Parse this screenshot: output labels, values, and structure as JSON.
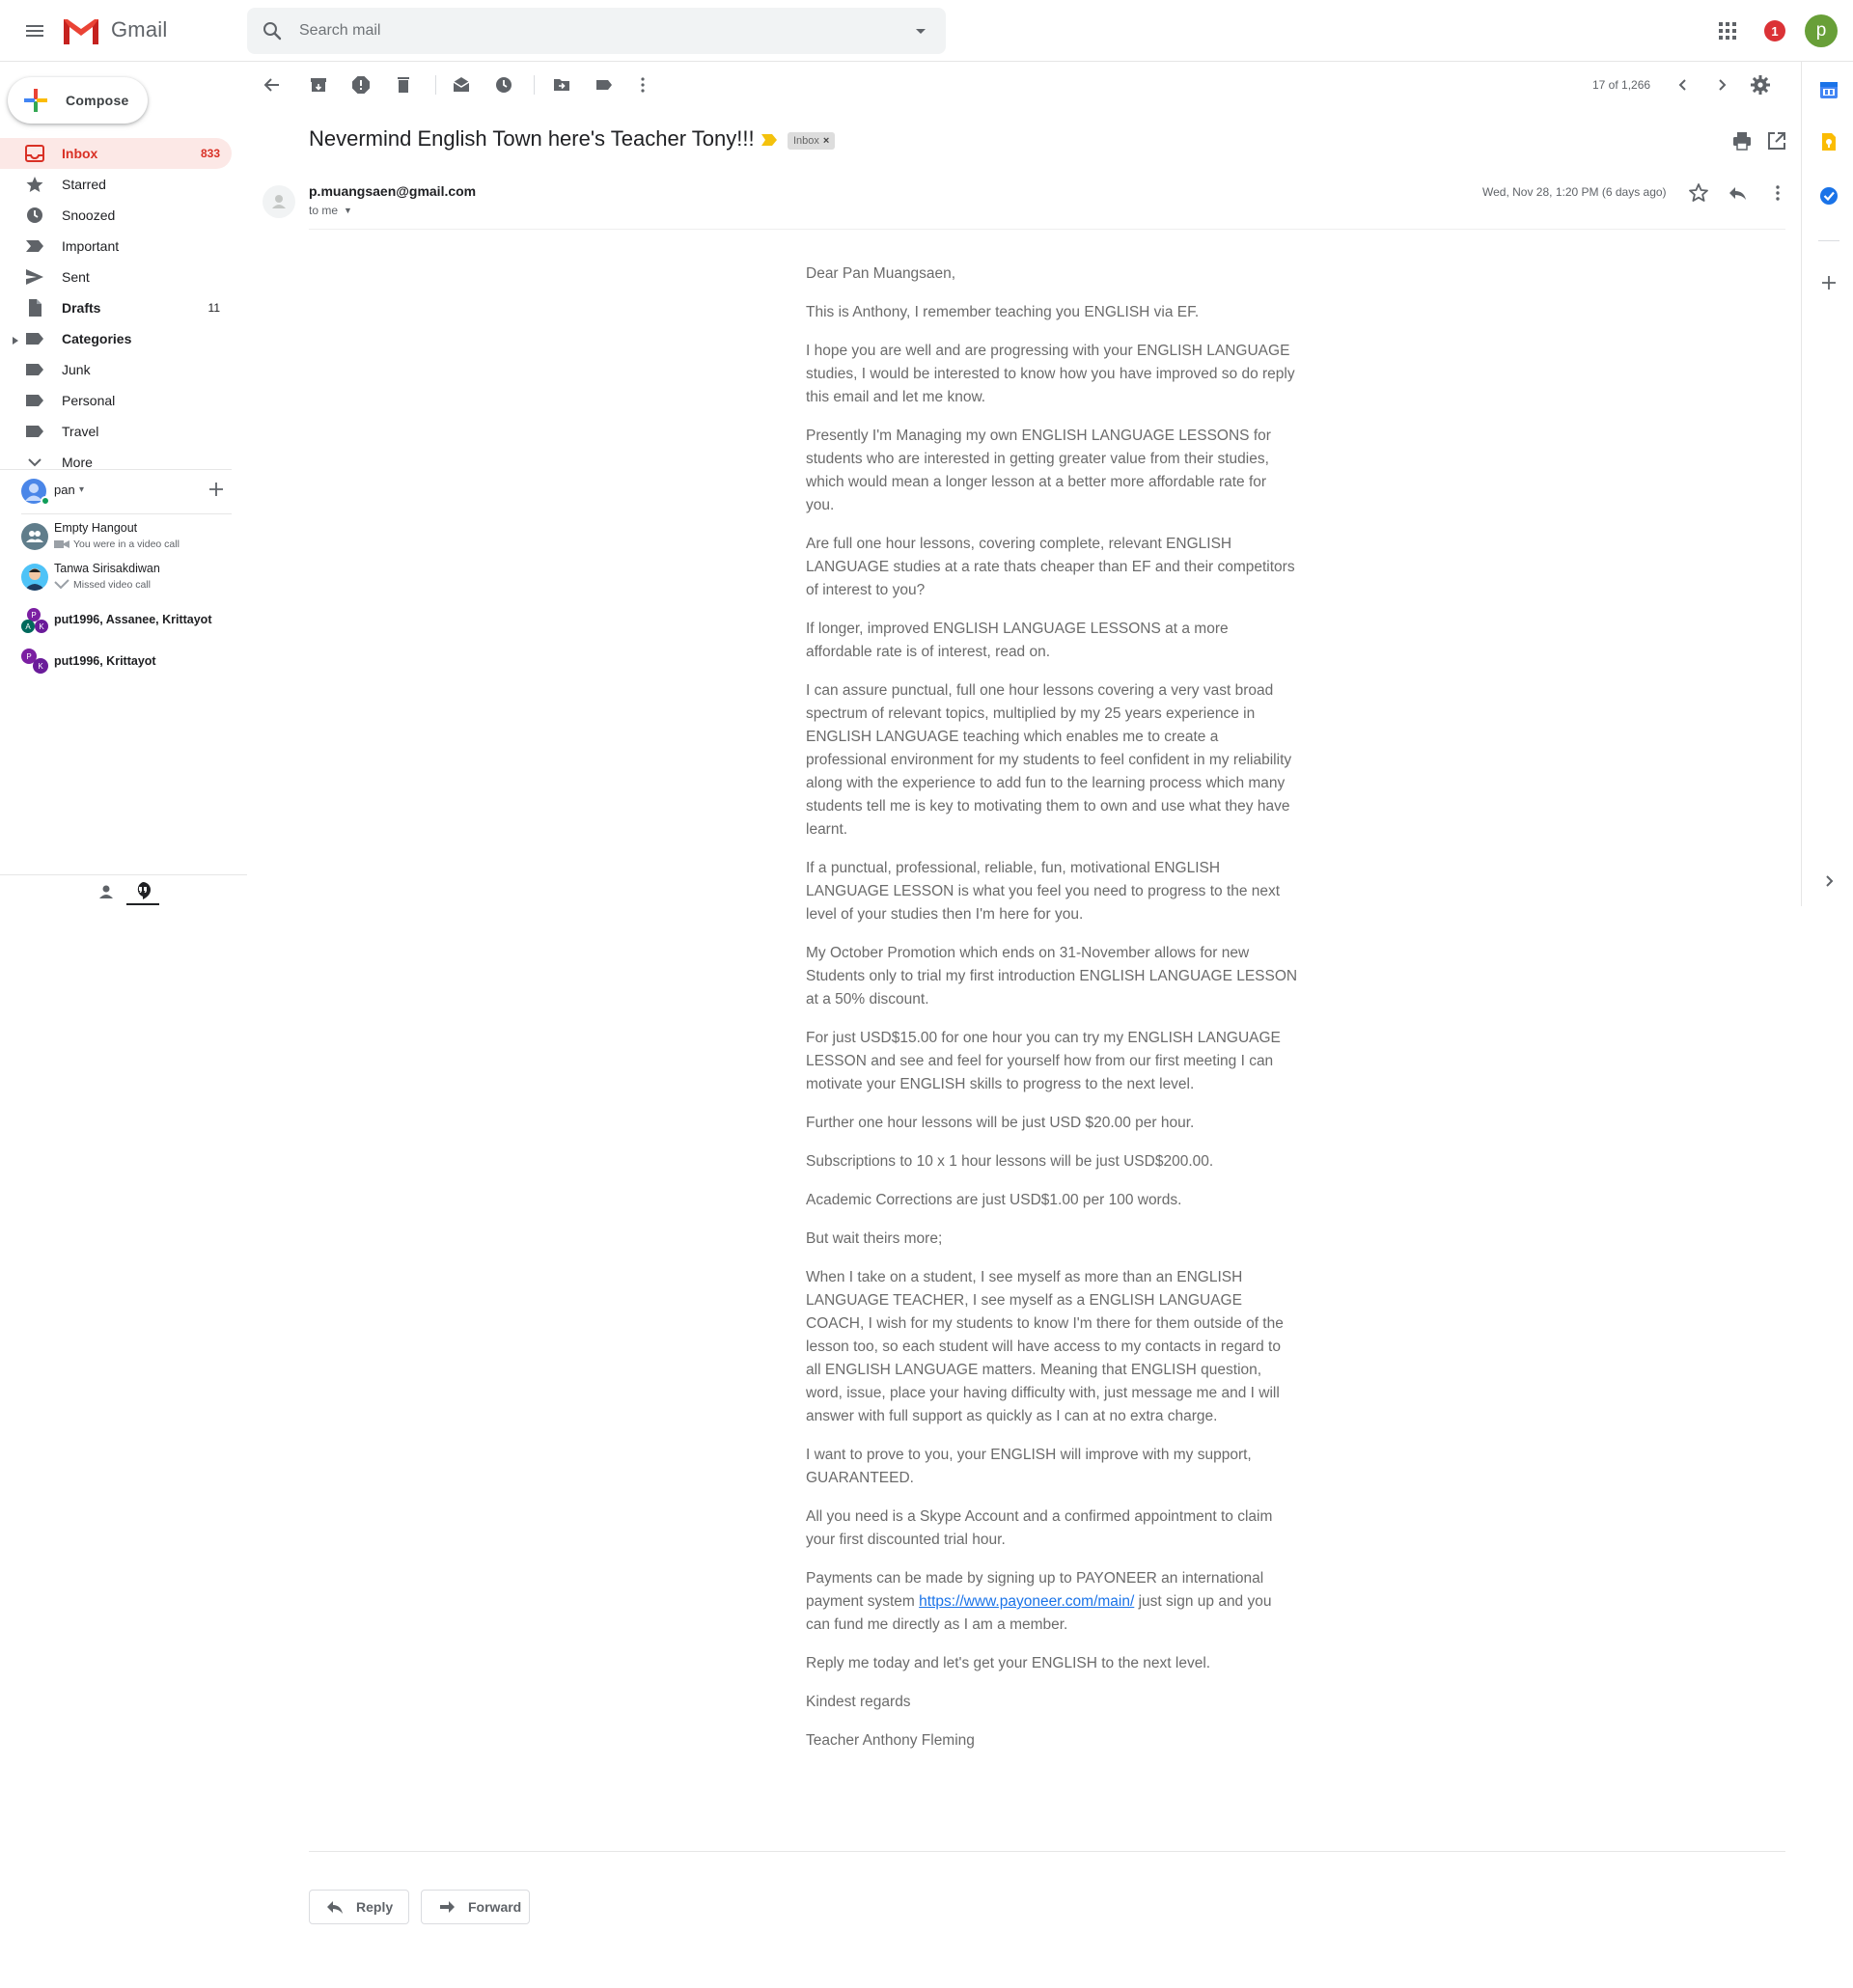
{
  "app": {
    "name": "Gmail"
  },
  "search": {
    "placeholder": "Search mail"
  },
  "header": {
    "notification_count": "1",
    "account_initial": "p"
  },
  "sidebar": {
    "compose_label": "Compose",
    "items": [
      {
        "label": "Inbox",
        "count": "833",
        "icon": "inbox-icon"
      },
      {
        "label": "Starred",
        "count": "",
        "icon": "star-icon"
      },
      {
        "label": "Snoozed",
        "count": "",
        "icon": "clock-icon"
      },
      {
        "label": "Important",
        "count": "",
        "icon": "important-icon"
      },
      {
        "label": "Sent",
        "count": "",
        "icon": "send-icon"
      },
      {
        "label": "Drafts",
        "count": "11",
        "icon": "draft-icon"
      },
      {
        "label": "Categories",
        "count": "",
        "icon": "label-icon"
      },
      {
        "label": "Junk",
        "count": "",
        "icon": "label-icon"
      },
      {
        "label": "Personal",
        "count": "",
        "icon": "label-icon"
      },
      {
        "label": "Travel",
        "count": "",
        "icon": "label-icon"
      },
      {
        "label": "More",
        "count": "",
        "icon": "chevron-down-icon"
      }
    ]
  },
  "hangouts": {
    "user_name": "pan",
    "contacts": [
      {
        "name": "Empty Hangout",
        "sub": "You were in a video call"
      },
      {
        "name": "Tanwa Sirisakdiwan",
        "sub": "Missed video call"
      },
      {
        "name": "put1996, Assanee, Krittayot",
        "sub": "",
        "initials": [
          "P",
          "A",
          "K"
        ]
      },
      {
        "name": "put1996, Krittayot",
        "sub": "",
        "initials": [
          "P",
          "K"
        ]
      }
    ]
  },
  "toolbar": {
    "pager": "17 of 1,266"
  },
  "message": {
    "subject": "Nevermind English Town here's Teacher Tony!!!",
    "label_chip": "Inbox",
    "label_chip_close": "×",
    "sender": "p.muangsaen@gmail.com",
    "recipient": "to me",
    "date": "Wed, Nov 28, 1:20 PM (6 days ago)",
    "body": [
      "Dear Pan Muangsaen,",
      "This is Anthony, I remember teaching you ENGLISH via EF.",
      "I hope you are well and are progressing with your ENGLISH LANGUAGE studies, I would be interested to know how you have improved so do reply this email and let me know.",
      "Presently I'm Managing my own ENGLISH LANGUAGE LESSONS for students who are interested in getting greater value from their studies, which would mean a longer lesson at a better more affordable rate for you.",
      "Are full one hour lessons, covering complete, relevant ENGLISH LANGUAGE studies at a rate thats cheaper than EF and their competitors of interest to you?",
      "If longer, improved ENGLISH LANGUAGE LESSONS at a more affordable rate is of interest, read on.",
      "I can assure punctual, full one hour lessons covering a very vast broad spectrum of relevant topics, multiplied by my 25 years experience in ENGLISH LANGUAGE teaching which enables me to create a professional environment for my students to feel confident in my reliability along with the experience to add fun to the learning process which many students tell me is key to motivating them to own and use what they have learnt.",
      "If a punctual, professional, reliable, fun, motivational ENGLISH LANGUAGE LESSON is what you feel you need to progress to the next level of your studies then I'm here for you.",
      "My October Promotion which ends on 31-November allows for new Students only to trial my first introduction ENGLISH LANGUAGE LESSON at a 50% discount.",
      "For just USD$15.00 for one hour you can try my ENGLISH LANGUAGE LESSON and see and feel for yourself how from our first meeting I can motivate your ENGLISH skills to progress to the next level.",
      "Further one hour lessons will be just USD $20.00 per hour.",
      "Subscriptions to 10 x 1 hour lessons will be just USD$200.00.",
      "Academic Corrections are just USD$1.00 per 100 words.",
      "But wait theirs more;",
      "When I take on a student, I see myself as more than an ENGLISH LANGUAGE TEACHER, I see myself as a ENGLISH LANGUAGE COACH, I wish for my students to know I'm there for them outside of the lesson too, so each student will have access to my contacts in regard to all ENGLISH LANGUAGE matters. Meaning that ENGLISH question, word, issue, place your having difficulty with, just message me and I will answer with full support as quickly as I can at no extra charge.",
      "I want to prove to you, your ENGLISH will improve with my support, GUARANTEED.",
      "All you need is a Skype Account and a confirmed appointment to claim your first discounted trial hour."
    ],
    "payment_before": "Payments can be made by signing up to PAYONEER an international payment system ",
    "payment_link": "https://www.payoneer.com/main/",
    "payment_after": " just sign up and you can fund me directly as I am a member.",
    "closing": [
      "Reply me today and let's get your ENGLISH to the next level.",
      "Kindest regards",
      "Teacher Anthony Fleming"
    ],
    "reply_label": "Reply",
    "forward_label": "Forward"
  },
  "colors": {
    "accent_red": "#d93025",
    "inbox_active_bg": "#fce8e6",
    "link": "#1a73e8",
    "badge_red": "#db3236",
    "avatar_green": "#689f38"
  }
}
